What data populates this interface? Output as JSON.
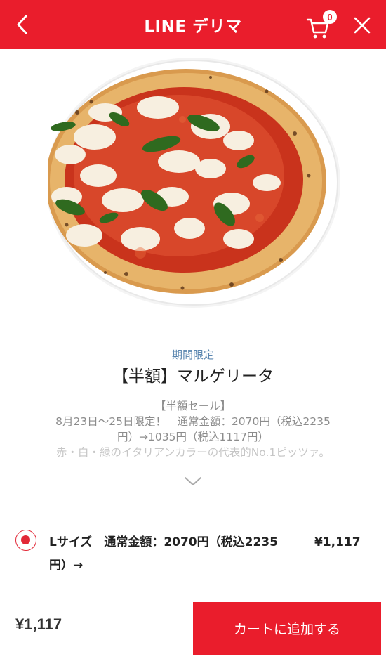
{
  "header": {
    "brand": "LINE デリマ",
    "cart_count": "0"
  },
  "product": {
    "badge": "期間限定",
    "title": "【半額】マルゲリータ",
    "desc_lines": [
      "【半額セール】",
      "8月23日〜25日限定！　通常金額：2070円（税込2235",
      "円）→1035円（税込1117円）",
      "赤・白・緑のイタリアンカラーの代表的No.1ピッツァ。"
    ]
  },
  "option": {
    "label_line1": "Lサイズ　通常金額：2070円（税込2235",
    "label_line2": "円）→",
    "price": "¥1,117"
  },
  "footer": {
    "total": "¥1,117",
    "add_to_cart": "カートに追加する"
  },
  "icons": {
    "back": "chevron-left-icon",
    "cart": "cart-icon",
    "close": "close-icon",
    "expand": "chevron-down-icon"
  },
  "colors": {
    "brand_red": "#ea1d2c",
    "badge_blue": "#5a86b0"
  }
}
